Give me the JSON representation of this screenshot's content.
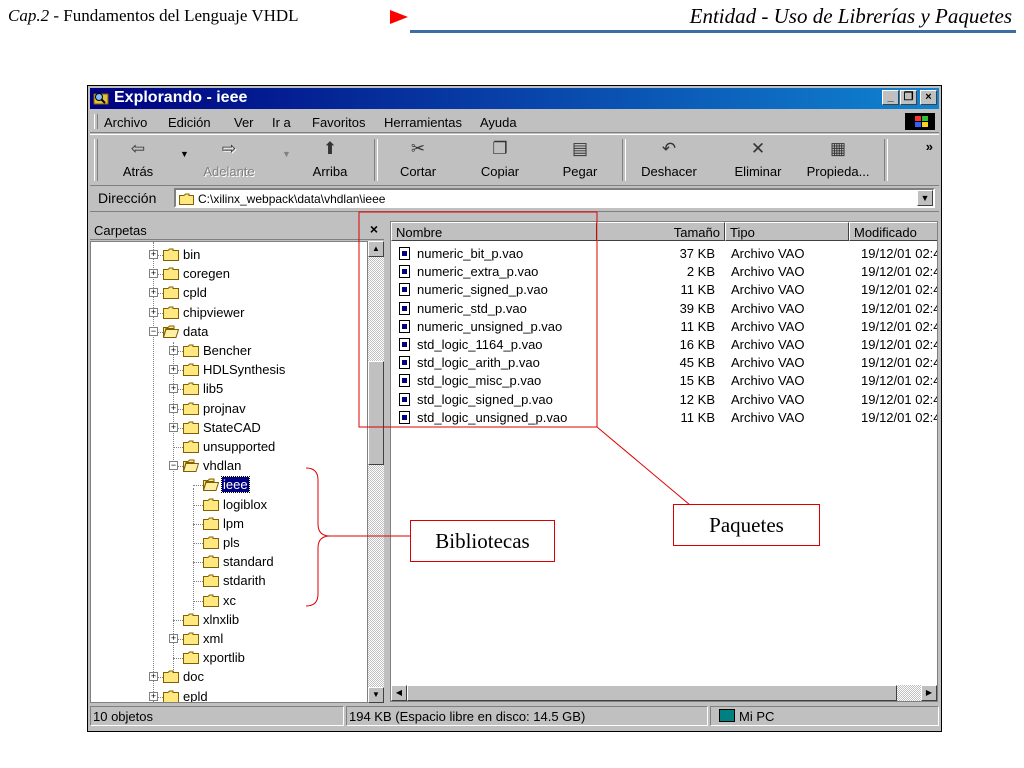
{
  "slide": {
    "header_cap": "Cap.2",
    "header_rest": " - Fundamentos del Lenguaje VHDL",
    "header_right": "Entidad - Uso de Librerías y Paquetes",
    "accent_color": "#3a6ea5",
    "arrow_color": "#ff0000"
  },
  "window": {
    "title": "Explorando - ieee",
    "title_icon": "explorer-icon",
    "buttons": [
      "minimize",
      "restore",
      "close"
    ]
  },
  "menu": [
    "Archivo",
    "Edición",
    "Ver",
    "Ir a",
    "Favoritos",
    "Herramientas",
    "Ayuda"
  ],
  "toolbar": {
    "back": "Atrás",
    "forward": "Adelante",
    "up": "Arriba",
    "cut": "Cortar",
    "copy": "Copiar",
    "paste": "Pegar",
    "undo": "Deshacer",
    "delete": "Eliminar",
    "properties": "Propieda...",
    "more": "»"
  },
  "address": {
    "label": "Dirección",
    "value": "C:\\xilinx_webpack\\data\\vhdlan\\ieee"
  },
  "folders": {
    "title": "Carpetas",
    "close": "×",
    "items": [
      "bin",
      "coregen",
      "cpld",
      "chipviewer",
      "data",
      "Bencher",
      "HDLSynthesis",
      "lib5",
      "projnav",
      "StateCAD",
      "unsupported",
      "vhdlan",
      "ieee",
      "logiblox",
      "lpm",
      "pls",
      "standard",
      "stdarith",
      "xc",
      "xlnxlib",
      "xml",
      "xportlib",
      "doc",
      "epld"
    ]
  },
  "files": {
    "columns": [
      "Nombre",
      "Tamaño",
      "Tipo",
      "Modificado"
    ],
    "rows": [
      {
        "name": "numeric_bit_p.vao",
        "size": "37 KB",
        "type": "Archivo VAO",
        "date": "19/12/01 02:4"
      },
      {
        "name": "numeric_extra_p.vao",
        "size": "2 KB",
        "type": "Archivo VAO",
        "date": "19/12/01 02:4"
      },
      {
        "name": "numeric_signed_p.vao",
        "size": "11 KB",
        "type": "Archivo VAO",
        "date": "19/12/01 02:4"
      },
      {
        "name": "numeric_std_p.vao",
        "size": "39 KB",
        "type": "Archivo VAO",
        "date": "19/12/01 02:4"
      },
      {
        "name": "numeric_unsigned_p.vao",
        "size": "11 KB",
        "type": "Archivo VAO",
        "date": "19/12/01 02:4"
      },
      {
        "name": "std_logic_1164_p.vao",
        "size": "16 KB",
        "type": "Archivo VAO",
        "date": "19/12/01 02:4"
      },
      {
        "name": "std_logic_arith_p.vao",
        "size": "45 KB",
        "type": "Archivo VAO",
        "date": "19/12/01 02:4"
      },
      {
        "name": "std_logic_misc_p.vao",
        "size": "15 KB",
        "type": "Archivo VAO",
        "date": "19/12/01 02:4"
      },
      {
        "name": "std_logic_signed_p.vao",
        "size": "12 KB",
        "type": "Archivo VAO",
        "date": "19/12/01 02:4"
      },
      {
        "name": "std_logic_unsigned_p.vao",
        "size": "11 KB",
        "type": "Archivo VAO",
        "date": "19/12/01 02:4"
      }
    ]
  },
  "status": {
    "count": "10 objetos",
    "space": "194 KB (Espacio libre en disco: 14.5 GB)",
    "location": "Mi PC"
  },
  "annotations": {
    "bibliotecas": "Bibliotecas",
    "paquetes": "Paquetes",
    "color": "#dd0000"
  }
}
